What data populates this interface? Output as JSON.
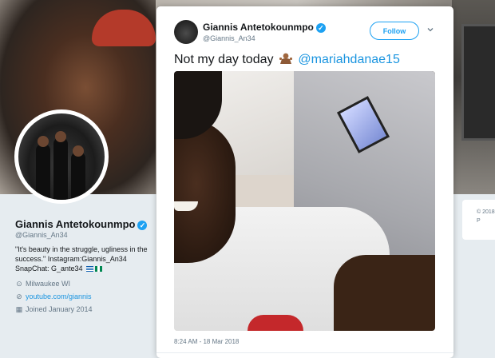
{
  "tweet": {
    "author_name": "Giannis Antetokounmpo",
    "author_handle": "@Giannis_An34",
    "follow_label": "Follow",
    "text": "Not my day today",
    "mention": "@mariahdanae15",
    "timestamp": "8:24 AM - 18 Mar 2018"
  },
  "profile": {
    "name": "Giannis Antetokounmpo",
    "handle": "@Giannis_An34",
    "bio": "\"It's beauty in the struggle, ugliness in the success.\" Instagram:Giannis_An34 SnapChat: G_ante34",
    "location": "Milwaukee WI",
    "website": "youtube.com/giannis",
    "joined": "Joined January 2014"
  },
  "side_card": {
    "line1": "© 2018",
    "line2": "P"
  },
  "icons": {
    "verified": "verified-badge-icon",
    "chevron": "chevron-down-icon",
    "location": "location-pin-icon",
    "link": "link-icon",
    "calendar": "calendar-icon",
    "emoji": "person-shrugging-emoji"
  },
  "colors": {
    "accent": "#1da1f2",
    "link": "#1b95e0",
    "muted": "#657786",
    "text": "#14171a"
  }
}
